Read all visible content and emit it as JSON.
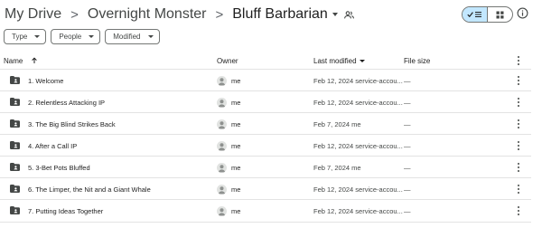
{
  "breadcrumb": {
    "root": "My Drive",
    "sep1": ">",
    "parent": "Overnight Monster",
    "sep2": ">",
    "current": "Bluff Barbarian"
  },
  "filters": [
    "Type",
    "People",
    "Modified"
  ],
  "columns": {
    "name": "Name",
    "owner": "Owner",
    "last_modified": "Last modified",
    "file_size": "File size"
  },
  "rows": [
    {
      "name": "1. Welcome",
      "owner": "me",
      "modified": "Feb 12, 2024 service-accou...",
      "size": "—"
    },
    {
      "name": "2. Relentless Attacking IP",
      "owner": "me",
      "modified": "Feb 12, 2024 service-accou...",
      "size": "—"
    },
    {
      "name": "3. The Big Blind Strikes Back",
      "owner": "me",
      "modified": "Feb 7, 2024 me",
      "size": "—"
    },
    {
      "name": "4. After a Call IP",
      "owner": "me",
      "modified": "Feb 12, 2024 service-accou...",
      "size": "—"
    },
    {
      "name": "5. 3-Bet Pots Bluffed",
      "owner": "me",
      "modified": "Feb 7, 2024 me",
      "size": "—"
    },
    {
      "name": "6. The Limper, the Nit and a Giant Whale",
      "owner": "me",
      "modified": "Feb 12, 2024 service-accou...",
      "size": "—"
    },
    {
      "name": "7. Putting Ideas Together",
      "owner": "me",
      "modified": "Feb 12, 2024 service-accou...",
      "size": "—"
    }
  ],
  "colors": {
    "accent": "#c2e7ff",
    "text": "#1f1f1f",
    "muted": "#444746",
    "border": "#747775",
    "folder": "#444746"
  }
}
